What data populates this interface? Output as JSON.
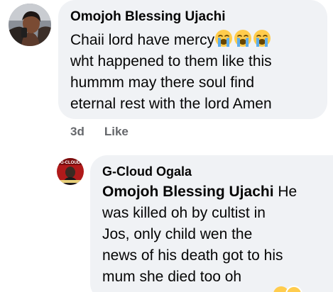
{
  "comment": {
    "author": "Omojoh Blessing Ujachi",
    "lines": [
      "Chaii lord have mercy",
      "wht happened to them like this",
      "hummm may there soul find",
      "eternal rest with the lord Amen"
    ],
    "emojis": [
      "loudly-crying-face",
      "loudly-crying-face",
      "loudly-crying-face"
    ],
    "time": "3d",
    "like_label": "Like"
  },
  "reply": {
    "author": "G-Cloud Ogala",
    "mention": "Omojoh Blessing Ujachi",
    "first_line_rest": " He",
    "lines": [
      "was killed oh by cultist in",
      "Jos, only child wen the",
      "news of his death got to his",
      "mum she died too oh"
    ]
  },
  "colors": {
    "bubble": "#f0f2f5",
    "text": "#050505",
    "meta": "#65676b",
    "emoji_yellow": "#ffcc4d",
    "tear_blue": "#5dadec"
  }
}
